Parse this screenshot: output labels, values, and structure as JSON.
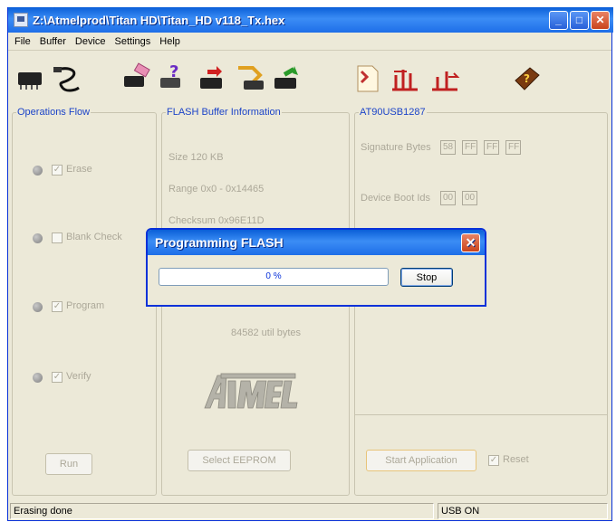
{
  "window": {
    "title": "Z:\\Atmelprod\\Titan HD\\Titan_HD v118_Tx.hex",
    "minimize": "_",
    "maximize": "□",
    "close": "✕"
  },
  "menu": [
    "File",
    "Buffer",
    "Device",
    "Settings",
    "Help"
  ],
  "toolbar": {
    "icons": [
      "chip-icon",
      "usb-cable-icon",
      "erase-chip-icon",
      "blank-check-icon",
      "program-chip-icon",
      "read-chip-icon",
      "verify-chip-icon",
      "load-file-icon",
      "load-buffer-icon",
      "save-buffer-icon",
      "help-book-icon"
    ]
  },
  "operations": {
    "title": "Operations Flow",
    "items": [
      {
        "label": "Erase",
        "checked": "✓"
      },
      {
        "label": "Blank Check",
        "checked": ""
      },
      {
        "label": "Program",
        "checked": "✓"
      },
      {
        "label": "Verify",
        "checked": "✓"
      }
    ],
    "run_label": "Run"
  },
  "flash_info": {
    "title": "FLASH Buffer Information",
    "size": "Size   120 KB",
    "range": "Range 0x0 - 0x14465",
    "checksum": "Checksum 0x96E11D",
    "bytes": "84582 util bytes",
    "select_eeprom": "Select EEPROM"
  },
  "device": {
    "title": "AT90USB1287",
    "signature_label": "Signature Bytes",
    "signature": [
      "58",
      "FF",
      "FF",
      "FF"
    ],
    "boot_label": "Device Boot Ids",
    "boot_ids": [
      "00",
      "00"
    ],
    "start_app": "Start Application",
    "reset_label": "Reset",
    "reset_checked": "✓"
  },
  "dialog": {
    "title": "Programming FLASH",
    "progress_text": "0 %",
    "progress": 0,
    "stop_label": "Stop",
    "close": "✕"
  },
  "status": {
    "left": "Erasing done",
    "right": "USB ON"
  },
  "colors": {
    "titlebar": "#2a74e8",
    "group_title": "#1c44c8",
    "disabled_text": "#aca899"
  }
}
